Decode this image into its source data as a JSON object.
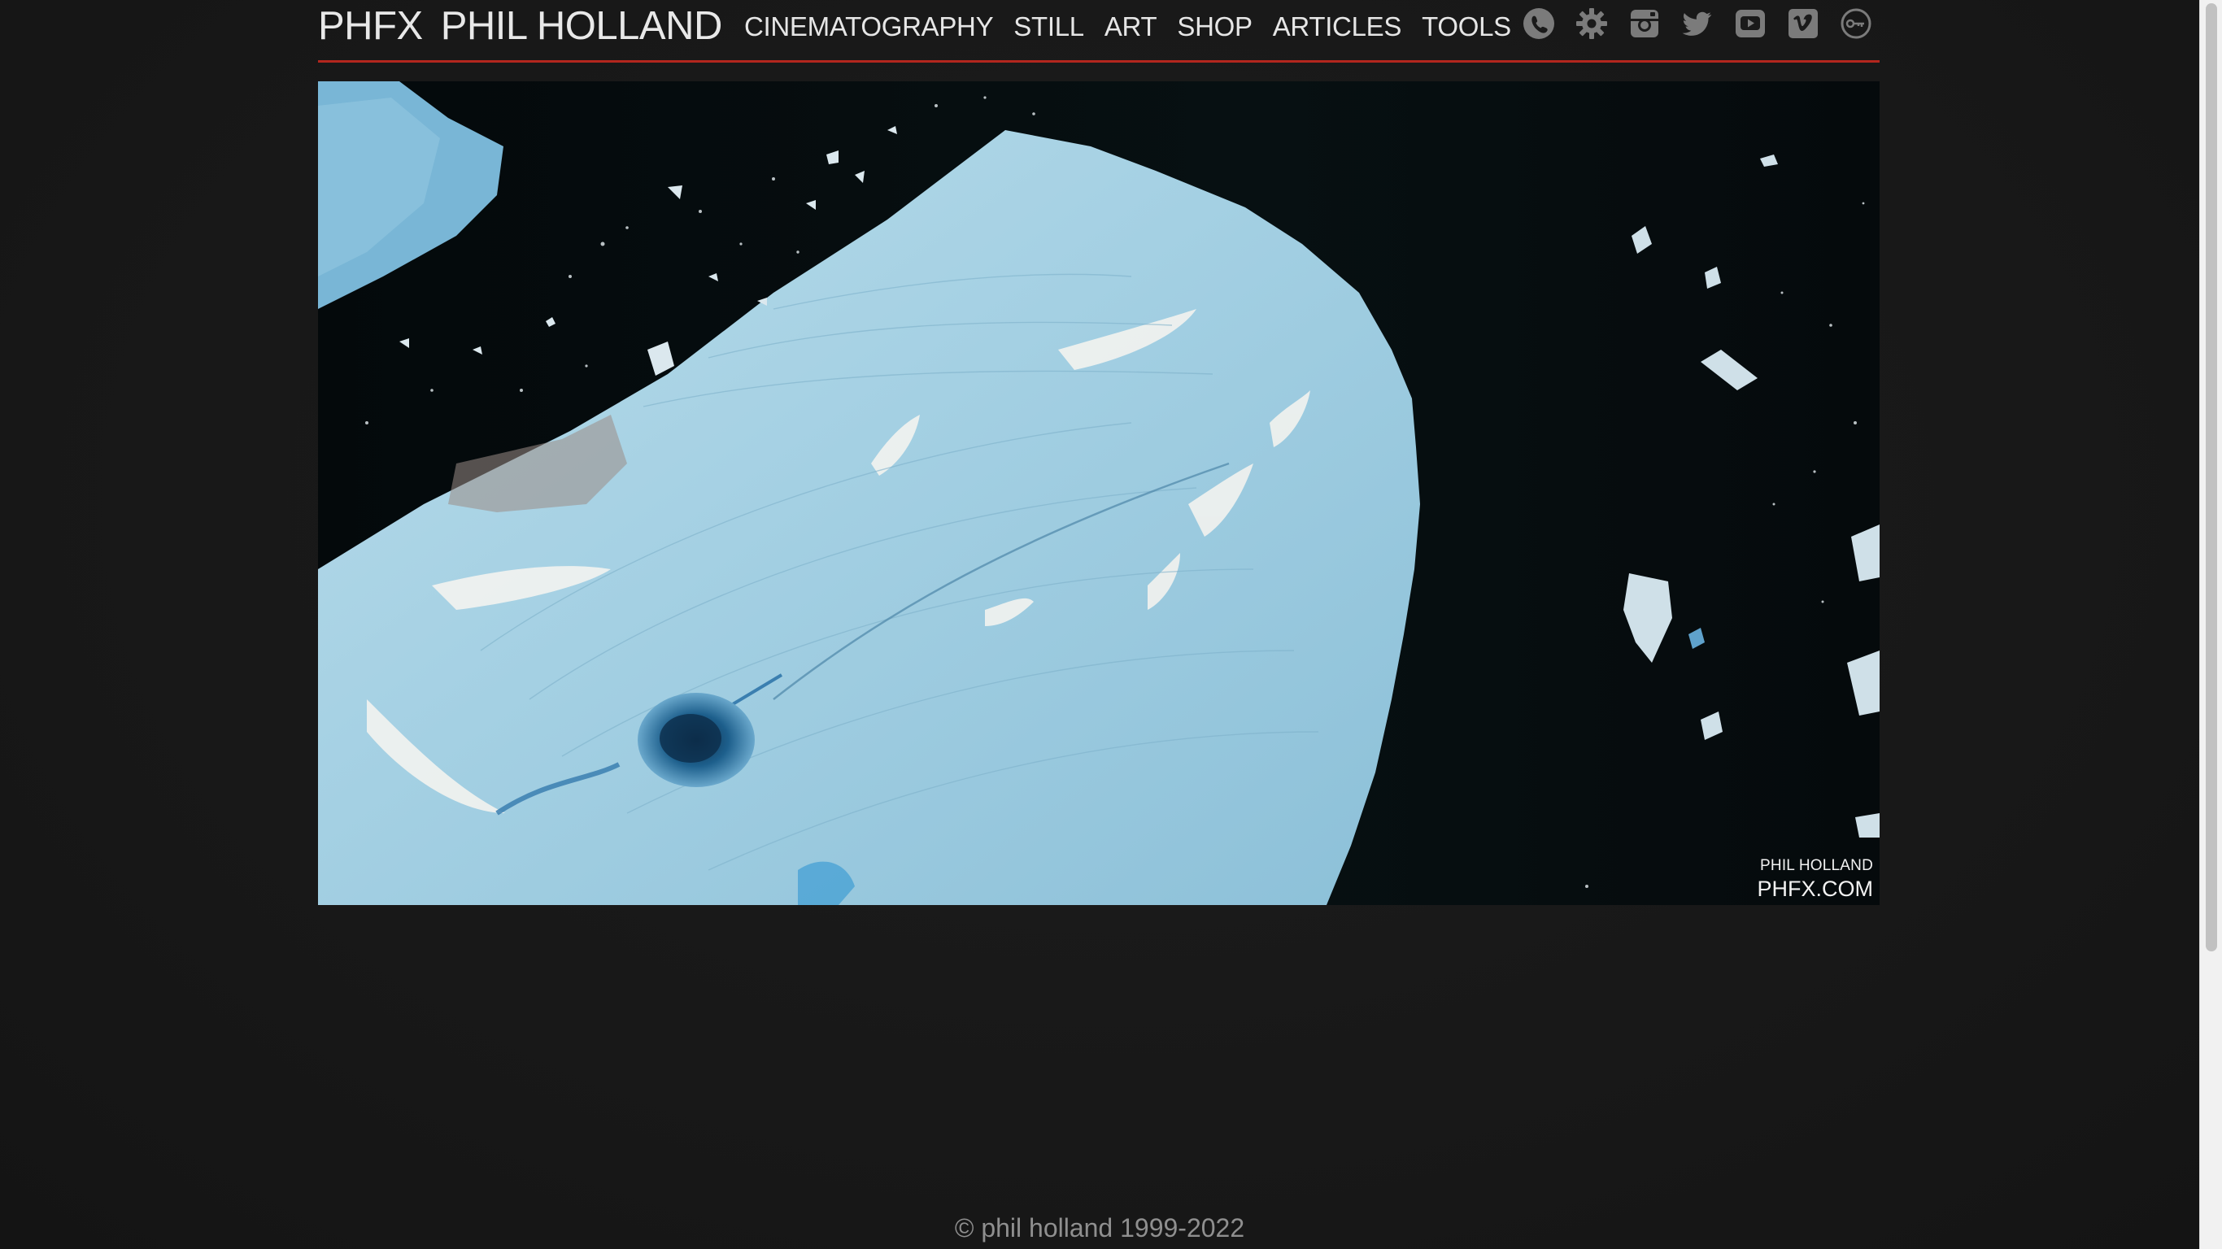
{
  "header": {
    "brand_short": "PHFX",
    "brand_name": "PHIL HOLLAND",
    "nav": [
      {
        "label": "CINEMATOGRAPHY"
      },
      {
        "label": "STILL"
      },
      {
        "label": "ART"
      },
      {
        "label": "SHOP"
      },
      {
        "label": "ARTICLES"
      },
      {
        "label": "TOOLS"
      }
    ],
    "icons": [
      "phone-icon",
      "gear-icon",
      "instagram-icon",
      "twitter-icon",
      "youtube-icon",
      "vimeo-icon",
      "key-icon"
    ],
    "accent_color": "#b3261e"
  },
  "photo": {
    "subject": "aerial view of iceberg in dark water",
    "watermark_name": "PHIL HOLLAND",
    "watermark_site": "PHFX.COM"
  },
  "footer": {
    "copyright": "© phil holland 1999-2022"
  },
  "colors": {
    "background": "#171717",
    "text": "#e6e6e6",
    "footer_text": "#8f8f8f",
    "ice": "#9fcde0",
    "water": "#050a0c"
  }
}
